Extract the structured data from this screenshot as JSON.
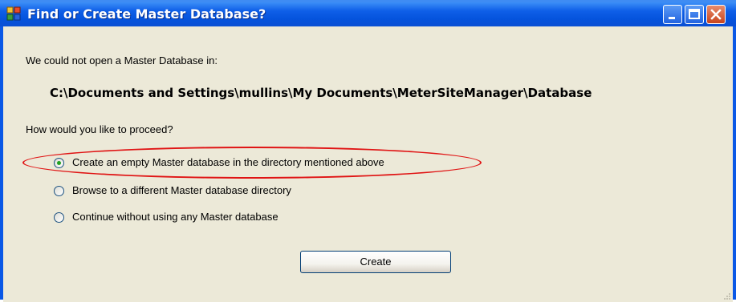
{
  "window": {
    "title": "Find or Create Master Database?",
    "icons": [
      "app-icon",
      "minimize-icon",
      "maximize-icon",
      "close-icon"
    ]
  },
  "dialog": {
    "message": "We could not open a Master Database in:",
    "path": "C:\\Documents and Settings\\mullins\\My Documents\\MeterSiteManager\\Database",
    "prompt": "How would you like to proceed?",
    "options": [
      {
        "label": "Create an empty Master database in the directory mentioned above",
        "selected": true
      },
      {
        "label": "Browse to a different Master database directory",
        "selected": false
      },
      {
        "label": "Continue without using any Master database",
        "selected": false
      }
    ],
    "button_label": "Create"
  },
  "colors": {
    "title_bar": "#0553dc",
    "client_bg": "#ece9d8",
    "highlight": "#e01414",
    "radio_selected": "#21a121"
  }
}
